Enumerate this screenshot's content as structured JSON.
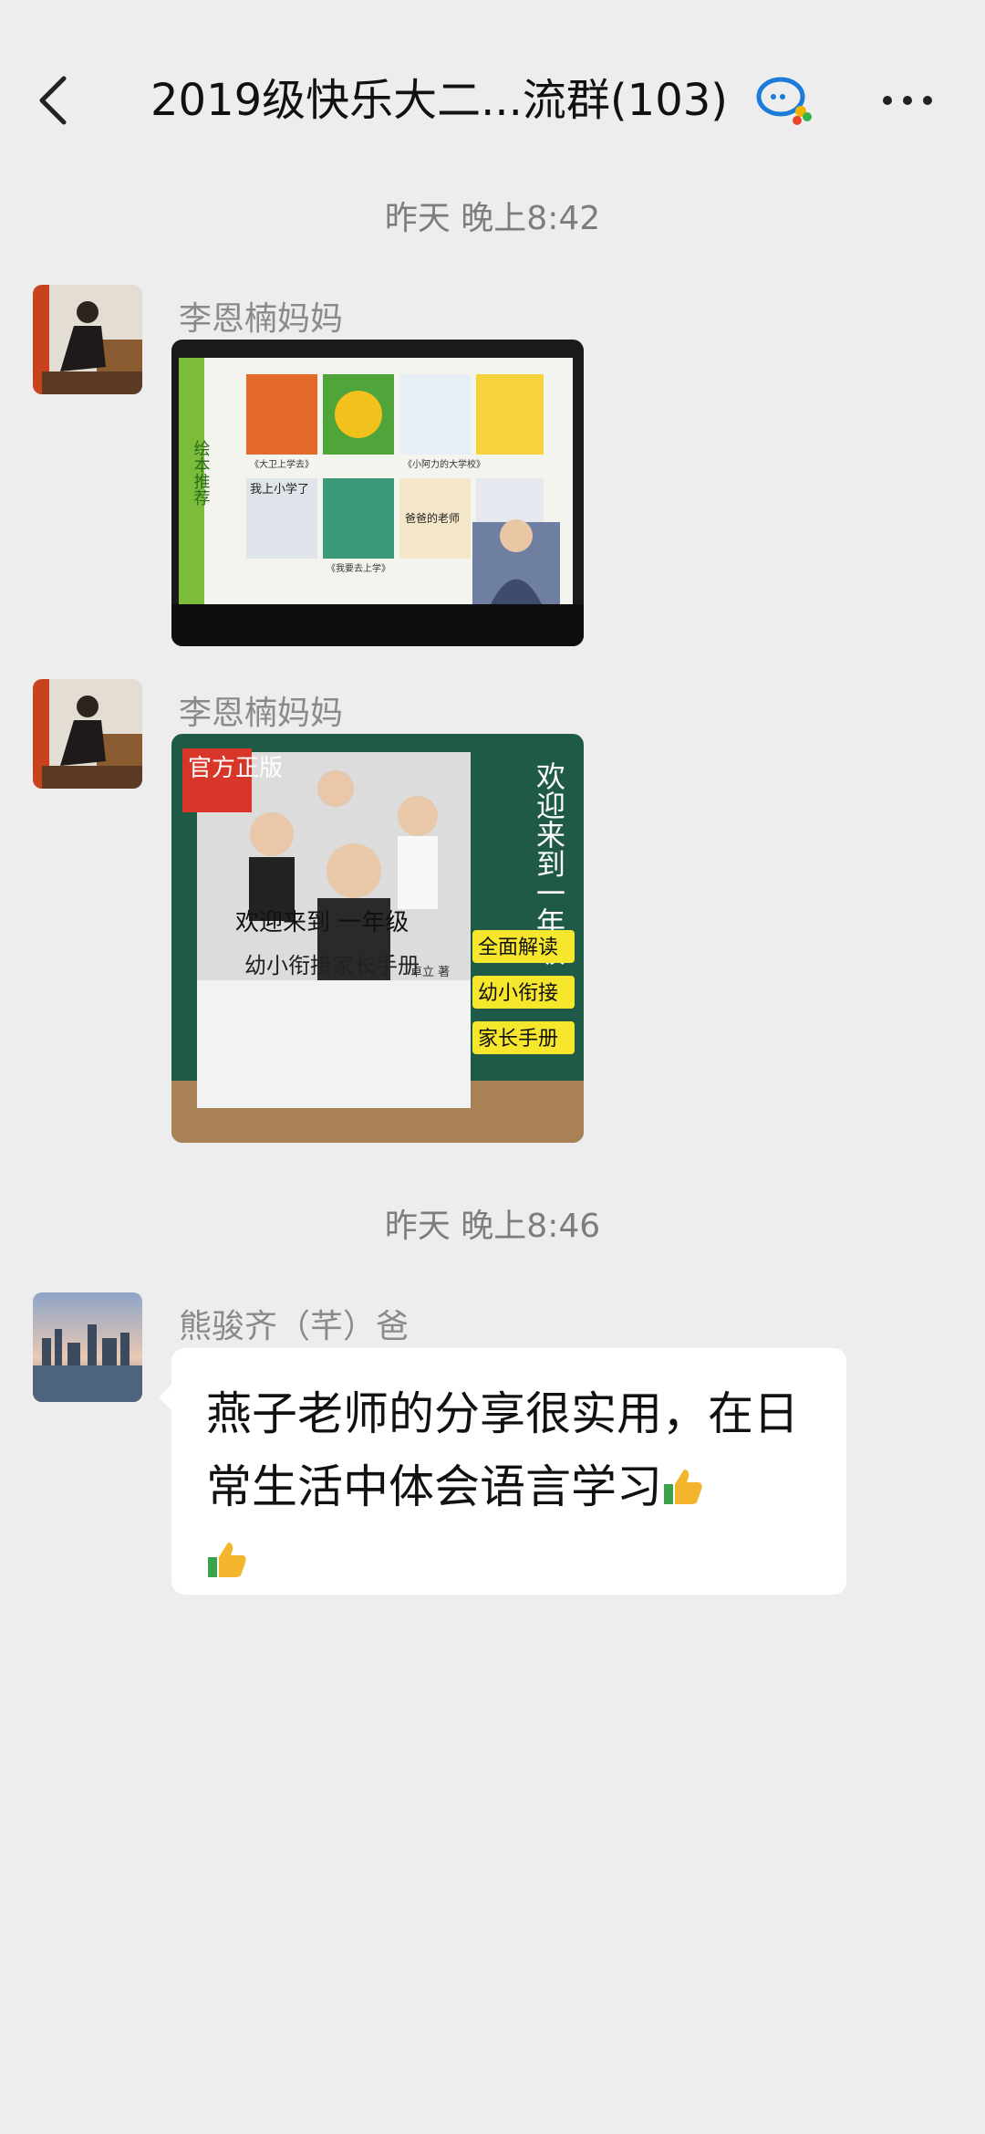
{
  "header": {
    "title": "2019级快乐大二...流群(103)",
    "back_icon": "chevron-left-icon",
    "group_icon": "chat-bubbles-icon",
    "more_icon": "more-dots-icon"
  },
  "messages": {
    "time1": "昨天 晚上8:42",
    "msg1": {
      "sender": "李恩楠妈妈"
    },
    "msg2": {
      "sender": "李恩楠妈妈"
    },
    "time2": "昨天 晚上8:46",
    "msg3": {
      "sender": "熊骏齐（芊）爸",
      "text": "燕子老师的分享很实用，在日常生活中体会语言学习"
    }
  },
  "slide": {
    "side_label": "绘本推荐",
    "captions": [
      "《大卫上学去》",
      "《小阿力的大学校》",
      "我上小学了",
      "《我要去上学》",
      "爸爸的老师"
    ]
  },
  "book": {
    "badge": "官方正版",
    "vertical_title": "欢迎来到一年级",
    "cover_title": "欢迎来到 一年级",
    "subtitle": "幼小衔接家长手册",
    "tag1": "全面解读",
    "tag2": "幼小衔接",
    "tag3": "家长手册",
    "author": "卓立 著"
  }
}
